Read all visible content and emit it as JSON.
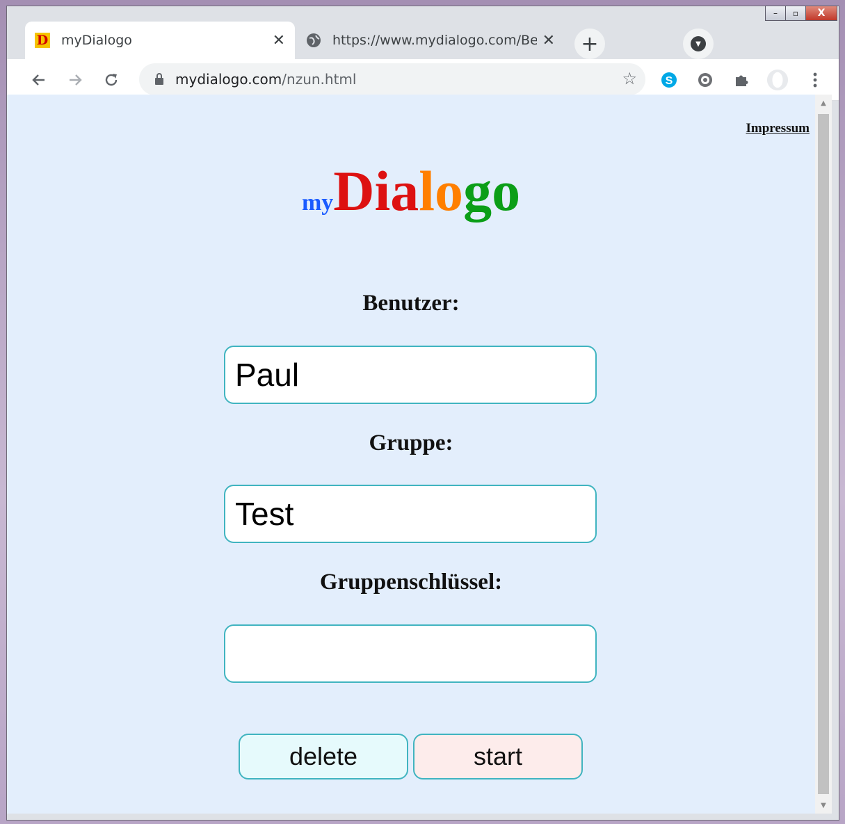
{
  "window": {
    "minimize": "–",
    "maximize": "▫",
    "close": "X"
  },
  "tabs": [
    {
      "label": "myDialogo",
      "favicon": "D",
      "close": "✕"
    },
    {
      "label": "https://www.mydialogo.com/Beschreibung",
      "close": "✕"
    }
  ],
  "toolbar": {
    "url_host": "mydialogo.com",
    "url_path": "/nzun.html"
  },
  "page": {
    "impressum": "Impressum",
    "logo": {
      "my": "my",
      "dia": "Dia",
      "lo": "lo",
      "go": "go"
    },
    "labels": {
      "user": "Benutzer:",
      "group": "Gruppe:",
      "group_key": "Gruppenschlüssel:"
    },
    "fields": {
      "user": "Paul",
      "group": "Test",
      "group_key": ""
    },
    "buttons": {
      "delete": "delete",
      "start": "start"
    }
  },
  "colors": {
    "logo_my": "#1a5bff",
    "logo_dia": "#dd1111",
    "logo_lo": "#ff7f00",
    "logo_go": "#0b9e17",
    "page_bg": "#e3eefc",
    "field_border": "#40b4c0",
    "delete_bg": "#e6fafc",
    "start_bg": "#fdeceb"
  },
  "icons": {
    "back": "arrow-left-icon",
    "forward": "arrow-right-icon",
    "reload": "reload-icon",
    "lock": "lock-icon",
    "star": "star-icon",
    "skype": "skype-icon",
    "extension": "puzzle-icon",
    "profile": "profile-icon",
    "menu": "kebab-menu-icon"
  }
}
